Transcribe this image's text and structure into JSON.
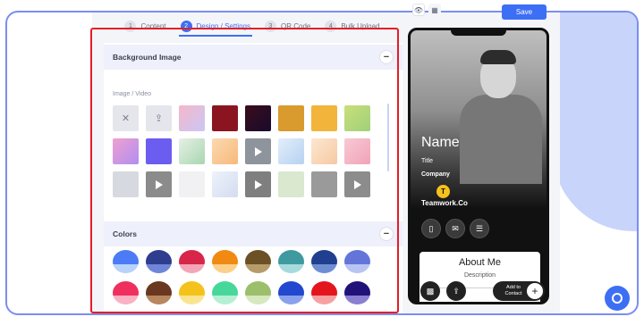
{
  "steps": [
    {
      "num": "1",
      "label": "Content"
    },
    {
      "num": "2",
      "label": "Design / Settings"
    },
    {
      "num": "3",
      "label": "QR Code"
    },
    {
      "num": "4",
      "label": "Bulk Upload"
    }
  ],
  "save_label": "Save",
  "background_section": {
    "title": "Background Image",
    "sub_label": "Image / Video",
    "collapse": "−"
  },
  "colors_section": {
    "title": "Colors",
    "collapse": "−"
  },
  "thumbnails": [
    {
      "kind": "none-icon",
      "glyph": "✕",
      "bg": "#e4e6ec"
    },
    {
      "kind": "upload-icon",
      "glyph": "⇪",
      "bg": "#e4e6ec"
    },
    {
      "kind": "image",
      "bg": "linear-gradient(135deg,#f6b7c9,#c9c7f6)"
    },
    {
      "kind": "image",
      "bg": "#8a1520"
    },
    {
      "kind": "image",
      "bg": "linear-gradient(135deg,#3a0d1a,#1a0a2e)"
    },
    {
      "kind": "image",
      "bg": "#d99a2e"
    },
    {
      "kind": "image",
      "bg": "#f2b43a"
    },
    {
      "kind": "image",
      "bg": "linear-gradient(135deg,#c9df7a,#9fd07a)"
    },
    {
      "kind": "image",
      "bg": "linear-gradient(135deg,#f0a0d0,#b08ef0)"
    },
    {
      "kind": "image",
      "bg": "#6b5df0"
    },
    {
      "kind": "image",
      "bg": "linear-gradient(135deg,#e6f0e4,#a8d6b0)"
    },
    {
      "kind": "image",
      "bg": "linear-gradient(135deg,#fbd9b2,#f7b97a)"
    },
    {
      "kind": "video",
      "bg": "#8e949c"
    },
    {
      "kind": "image",
      "bg": "linear-gradient(135deg,#e2eefb,#b6d2f0)"
    },
    {
      "kind": "image",
      "bg": "linear-gradient(135deg,#fce7cf,#f6c9a4)"
    },
    {
      "kind": "image",
      "bg": "linear-gradient(135deg,#f9c9d4,#f0a3b8)"
    },
    {
      "kind": "image",
      "bg": "#d7d9e0"
    },
    {
      "kind": "video",
      "bg": "#8b8b8b"
    },
    {
      "kind": "image",
      "bg": "#f1f1f3"
    },
    {
      "kind": "image",
      "bg": "linear-gradient(135deg,#eef2fb,#d3dcef)"
    },
    {
      "kind": "video",
      "bg": "#7f7f7f"
    },
    {
      "kind": "image",
      "bg": "#d9e8cf"
    },
    {
      "kind": "image",
      "bg": "#9a9a9a"
    },
    {
      "kind": "video",
      "bg": "#8c8c8c"
    }
  ],
  "color_swatches": [
    {
      "top": "#4b7cf5",
      "bottom": "#b9d2fb"
    },
    {
      "top": "#2f3d8e",
      "bottom": "#6f86d8"
    },
    {
      "top": "#d7264a",
      "bottom": "#f3a6b7"
    },
    {
      "top": "#f08a12",
      "bottom": "#fbd08a"
    },
    {
      "top": "#6b5125",
      "bottom": "#b59c6a"
    },
    {
      "top": "#3f9a9f",
      "bottom": "#a7dadd"
    },
    {
      "top": "#213f8f",
      "bottom": "#6e8ed4"
    },
    {
      "top": "#6475d9",
      "bottom": "#b9c4f3"
    },
    {
      "top": "#ef2f5e",
      "bottom": "#f9b1c3"
    },
    {
      "top": "#6a3820",
      "bottom": "#b8865f"
    },
    {
      "top": "#f5c21c",
      "bottom": "#fbe48f"
    },
    {
      "top": "#48d79a",
      "bottom": "#b5f0d4"
    },
    {
      "top": "#9bbf6a",
      "bottom": "#d6e8bd"
    },
    {
      "top": "#2348d0",
      "bottom": "#8aa1ec"
    },
    {
      "top": "#e4161d",
      "bottom": "#f7a0a2"
    },
    {
      "top": "#21127a",
      "bottom": "#8a7fd0"
    }
  ],
  "preview": {
    "name": "Name",
    "title": "Title",
    "company": "Company",
    "logo_letter": "T",
    "org": "Teamwork.Co",
    "action_icons": [
      "phone-icon",
      "mail-icon",
      "chat-icon"
    ],
    "about_title": "About Me",
    "about_desc": "Description",
    "add_contact": "Add to Contact",
    "plus": "+"
  },
  "accent": "#3d6ff5",
  "highlight": "#e41e26"
}
